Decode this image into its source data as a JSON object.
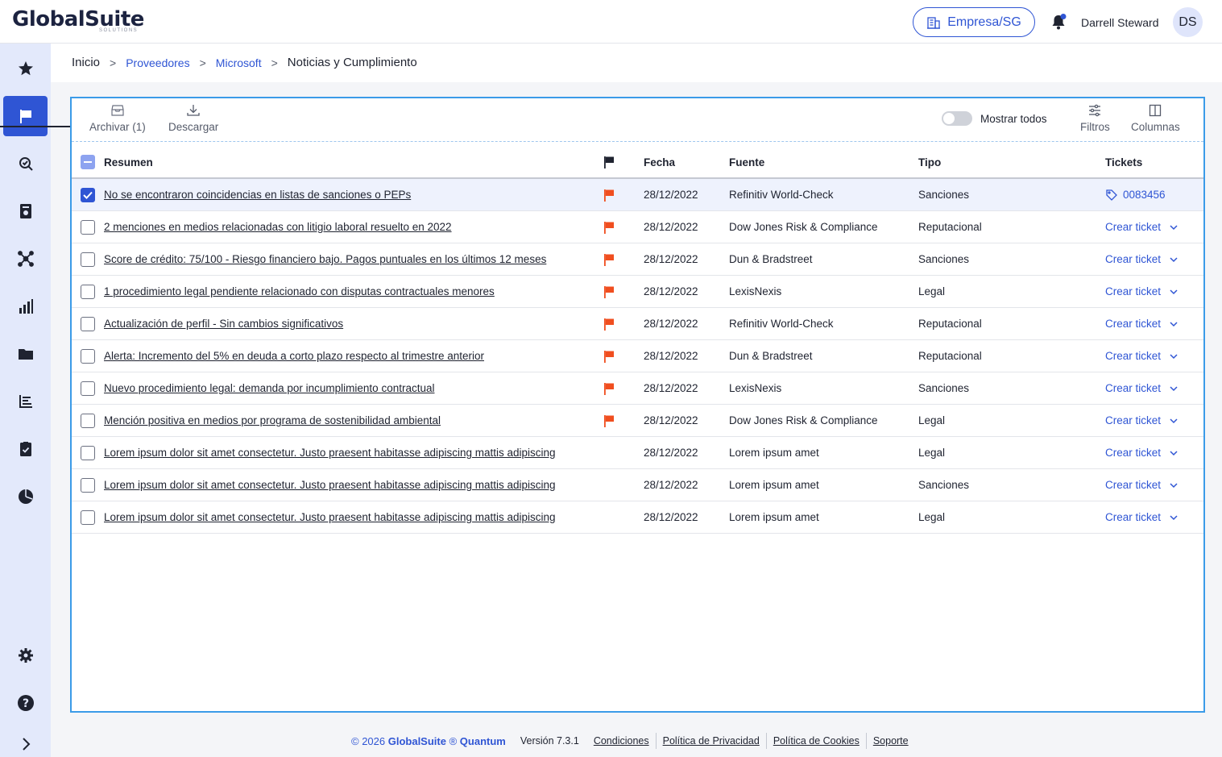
{
  "header": {
    "logo": "GlobalSuite",
    "logo_sub": "SOLUTIONS",
    "company": "Empresa/SG",
    "user_name": "Darrell Steward",
    "avatar_initials": "DS"
  },
  "sidebar": {
    "items": [
      {
        "icon": "star-icon"
      },
      {
        "icon": "flag-icon",
        "active": true
      },
      {
        "icon": "search-risk-icon"
      },
      {
        "icon": "report-icon"
      },
      {
        "icon": "network-icon"
      },
      {
        "icon": "bar-chart-icon"
      },
      {
        "icon": "folder-icon"
      },
      {
        "icon": "list-chart-icon"
      },
      {
        "icon": "clipboard-check-icon"
      },
      {
        "icon": "pie-chart-icon"
      },
      {
        "icon": "settings-icon"
      },
      {
        "icon": "help-icon"
      },
      {
        "icon": "chevron-right-icon"
      }
    ]
  },
  "breadcrumb": {
    "home": "Inicio",
    "level1": "Proveedores",
    "level2": "Microsoft",
    "current": "Noticias y Cumplimiento"
  },
  "toolbar": {
    "archive": "Archivar (1)",
    "download": "Descargar",
    "show_all": "Mostrar todos",
    "filters": "Filtros",
    "columns": "Columnas"
  },
  "table": {
    "headers": {
      "summary": "Resumen",
      "date": "Fecha",
      "source": "Fuente",
      "type": "Tipo",
      "tickets": "Tickets"
    },
    "rows": [
      {
        "summary": "No se encontraron coincidencias en listas de sanciones o PEPs",
        "flag": true,
        "date": "28/12/2022",
        "source": "Refinitiv World-Check",
        "type": "Sanciones",
        "ticket": "0083456",
        "checked": true
      },
      {
        "summary": "2 menciones en medios relacionadas con litigio laboral resuelto en 2022",
        "flag": true,
        "date": "28/12/2022",
        "source": "Dow Jones Risk & Compliance",
        "type": "Reputacional",
        "ticket": "Crear ticket"
      },
      {
        "summary": "Score de crédito: 75/100 - Riesgo financiero bajo. Pagos puntuales en los últimos 12 meses",
        "flag": true,
        "date": "28/12/2022",
        "source": "Dun & Bradstreet",
        "type": "Sanciones",
        "ticket": "Crear ticket"
      },
      {
        "summary": "1 procedimiento legal pendiente relacionado con disputas contractuales menores",
        "flag": true,
        "date": "28/12/2022",
        "source": "LexisNexis",
        "type": "Legal",
        "ticket": "Crear ticket"
      },
      {
        "summary": "Actualización de perfil - Sin cambios significativos",
        "flag": true,
        "date": "28/12/2022",
        "source": "Refinitiv World-Check",
        "type": "Reputacional",
        "ticket": "Crear ticket"
      },
      {
        "summary": "Alerta: Incremento del 5% en deuda a corto plazo respecto al trimestre anterior",
        "flag": true,
        "date": "28/12/2022",
        "source": "Dun & Bradstreet",
        "type": "Reputacional",
        "ticket": "Crear ticket"
      },
      {
        "summary": "Nuevo procedimiento legal: demanda por incumplimiento contractual",
        "flag": true,
        "date": "28/12/2022",
        "source": "LexisNexis",
        "type": "Sanciones",
        "ticket": "Crear ticket"
      },
      {
        "summary": "Mención positiva en medios por programa de sostenibilidad ambiental",
        "flag": true,
        "date": "28/12/2022",
        "source": "Dow Jones Risk & Compliance",
        "type": "Legal",
        "ticket": "Crear ticket"
      },
      {
        "summary": "Lorem ipsum dolor sit amet consectetur. Justo praesent habitasse adipiscing mattis adipiscing",
        "flag": false,
        "date": "28/12/2022",
        "source": "Lorem ipsum amet",
        "type": "Legal",
        "ticket": "Crear ticket"
      },
      {
        "summary": "Lorem ipsum dolor sit amet consectetur. Justo praesent habitasse adipiscing mattis adipiscing",
        "flag": false,
        "date": "28/12/2022",
        "source": "Lorem ipsum amet",
        "type": "Sanciones",
        "ticket": "Crear ticket"
      },
      {
        "summary": "Lorem ipsum dolor sit amet consectetur. Justo praesent habitasse adipiscing mattis adipiscing",
        "flag": false,
        "date": "28/12/2022",
        "source": "Lorem ipsum amet",
        "type": "Legal",
        "ticket": "Crear ticket"
      }
    ]
  },
  "footer": {
    "copyright_prefix": "© 2026 ",
    "brand": "GlobalSuite",
    "reg": " ® ",
    "product": "Quantum",
    "version": "Versión 7.3.1",
    "links": [
      "Condiciones",
      "Política de Privacidad",
      "Política de Cookies",
      "Soporte"
    ]
  },
  "colors": {
    "accent": "#2f55d4",
    "flag": "#f04e1f",
    "panel_border": "#3b9be8",
    "sidebar_bg": "#e3e9fb"
  }
}
